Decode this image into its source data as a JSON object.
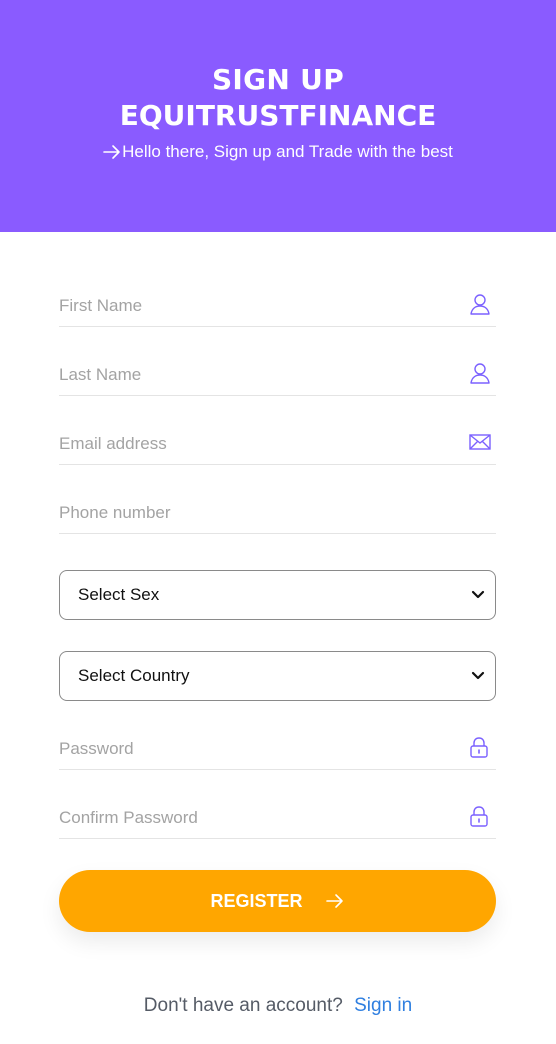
{
  "header": {
    "title_line1": "SIGN UP",
    "title_line2": "EQUITRUSTFINANCE",
    "subtitle": "Hello there, Sign up and Trade with the best",
    "background_color": "#8a5bff"
  },
  "form": {
    "first_name": {
      "placeholder": "First Name",
      "icon": "user-icon"
    },
    "last_name": {
      "placeholder": "Last Name",
      "icon": "user-icon"
    },
    "email": {
      "placeholder": "Email address",
      "icon": "envelope-icon"
    },
    "phone": {
      "placeholder": "Phone number"
    },
    "sex_select": {
      "selected": "Select Sex",
      "icon": "chevron-down-icon"
    },
    "country_select": {
      "selected": "Select Country",
      "icon": "chevron-down-icon"
    },
    "password": {
      "placeholder": "Password",
      "icon": "lock-icon"
    },
    "confirm_password": {
      "placeholder": "Confirm Password",
      "icon": "lock-icon"
    },
    "register_label": "REGISTER",
    "register_color": "#ffa600"
  },
  "footer": {
    "prompt": "Don't have an account?",
    "link_label": "Sign in",
    "link_color": "#2f7fe0"
  }
}
